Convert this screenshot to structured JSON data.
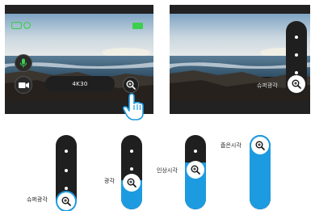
{
  "left_screen": {
    "resolution_label": "4K30",
    "icons": [
      "battery-outline-icon",
      "battery-full-icon",
      "microphone-icon",
      "video-camera-icon",
      "zoom-in-icon",
      "tap-hand-icon"
    ]
  },
  "right_screen": {
    "slider_label": "슈퍼광각",
    "icons": [
      "zoom-in-icon"
    ]
  },
  "sliders": [
    {
      "label": "슈퍼광각",
      "level": 0.0
    },
    {
      "label": "광각",
      "level": 0.33
    },
    {
      "label": "인상시각",
      "level": 0.66
    },
    {
      "label": "좁은시각",
      "level": 1.0
    }
  ],
  "colors": {
    "accent": "#1d9be0",
    "battery": "#3ccf4e",
    "screen_bezel": "#222222",
    "slider_track": "#1f1f1f"
  }
}
